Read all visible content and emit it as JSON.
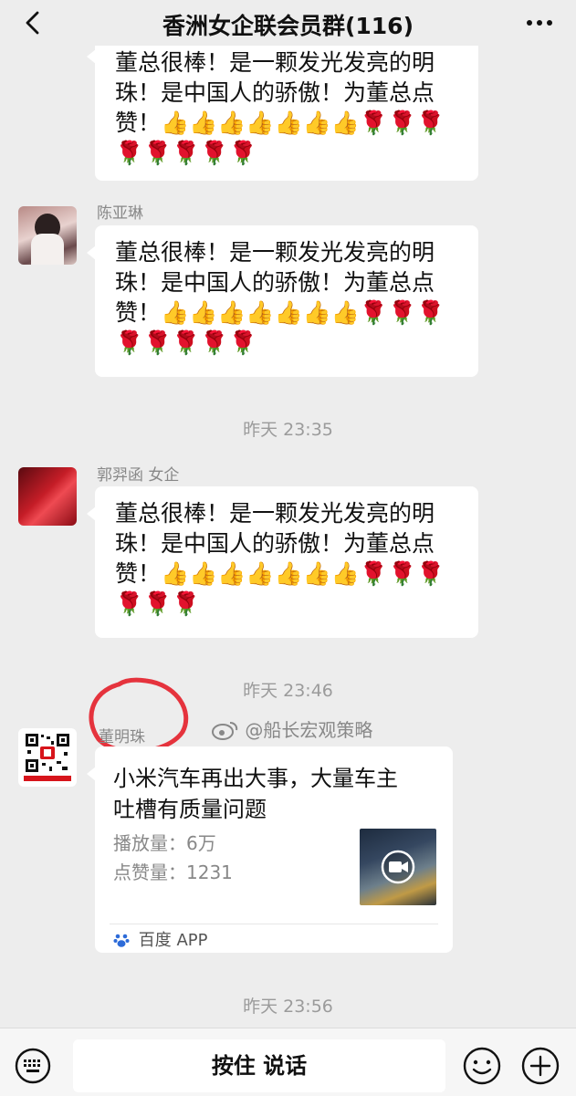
{
  "header": {
    "title": "香洲女企联会员群(116)"
  },
  "messages": [
    {
      "sender": "",
      "line1": "董总很棒！是一颗发光发亮的明",
      "line2": "珠！是中国人的骄傲！为董总点",
      "line3": "赞！👍👍👍👍👍👍👍🌹🌹🌹",
      "line4": "🌹🌹🌹🌹🌹"
    },
    {
      "sender": "陈亚琳",
      "line1": "董总很棒！是一颗发光发亮的明",
      "line2": "珠！是中国人的骄傲！为董总点",
      "line3": "赞！👍👍👍👍👍👍👍🌹🌹🌹",
      "line4": "🌹🌹🌹🌹🌹"
    },
    {
      "sender": "郭羿函 女企",
      "line1": "董总很棒！是一颗发光发亮的明",
      "line2": "珠！是中国人的骄傲！为董总点",
      "line3": "赞！👍👍👍👍👍👍👍🌹🌹🌹",
      "line4": "🌹🌹🌹"
    }
  ],
  "timestamps": [
    "昨天 23:35",
    "昨天 23:46",
    "昨天 23:56"
  ],
  "shared": {
    "sender": "董明珠",
    "weibo_watermark": "@船长宏观策略",
    "title_line1": "小米汽车再出大事，大量车主",
    "title_line2": "吐槽有质量问题",
    "plays": "播放量：6万",
    "likes": "点赞量：1231",
    "source": "百度 APP"
  },
  "input": {
    "hold_to_talk": "按住 说话"
  },
  "icons": [
    "back-icon",
    "more-icon",
    "keyboard-icon",
    "emoji-icon",
    "plus-icon",
    "video-play-icon",
    "baidu-paw-icon",
    "weibo-icon"
  ]
}
